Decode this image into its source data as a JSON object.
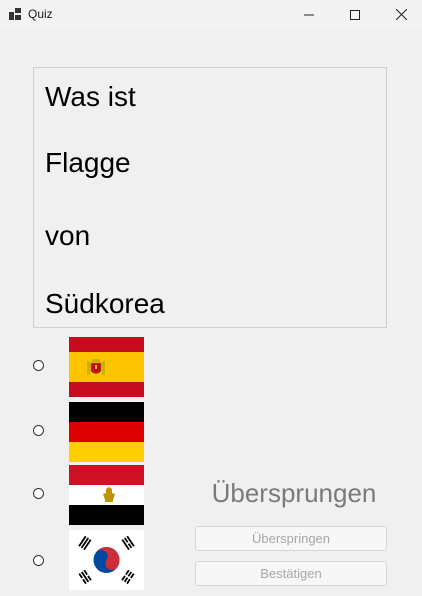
{
  "window": {
    "title": "Quiz",
    "icons": [
      "app-icon",
      "minimize-icon",
      "maximize-icon",
      "close-icon"
    ]
  },
  "question": {
    "lines": [
      "Was ist",
      "Flagge",
      "von",
      "Südkorea"
    ]
  },
  "options": [
    {
      "flag": "spain-flag",
      "selected": false
    },
    {
      "flag": "germany-flag",
      "selected": false
    },
    {
      "flag": "egypt-flag",
      "selected": false
    },
    {
      "flag": "south-korea-flag",
      "selected": false
    }
  ],
  "status": {
    "text": "Übersprungen"
  },
  "buttons": {
    "skip_label": "Überspringen",
    "confirm_label": "Bestätigen"
  },
  "colors": {
    "spain_red": "#c60b1e",
    "spain_yellow": "#ffc400",
    "germany_black": "#000000",
    "germany_red": "#dd0000",
    "germany_gold": "#ffce00",
    "egypt_red": "#ce1126",
    "egypt_black": "#000000",
    "korea_red": "#cd2e3a",
    "korea_blue": "#0047a0"
  }
}
